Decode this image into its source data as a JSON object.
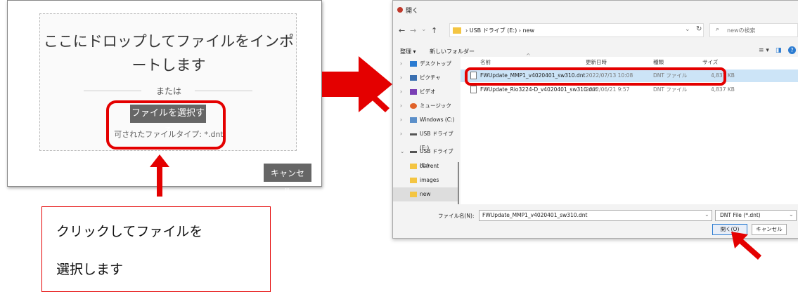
{
  "import_panel": {
    "drop_text_line1": "ここにドロップしてファイルをインポ",
    "drop_text_line2": "ートします",
    "or_label": "または",
    "select_button": "ファイルを選択する",
    "allowed_types": "可されたファイルタイプ: *.dnt",
    "cancel_button": "キャンセル"
  },
  "callout": {
    "line1": "クリックしてファイルを",
    "line2": "選択します"
  },
  "dialog": {
    "title": "開く",
    "nav_back": "←",
    "nav_forward": "→",
    "nav_dropdown": "⌄",
    "nav_up": "↑",
    "address_path": "›  USB ドライブ (E:)  ›  new",
    "address_chevron": "⌄",
    "refresh": "↻",
    "search_icon": "⌕",
    "search_placeholder": "newの検索",
    "organize": "整理 ▾",
    "new_folder": "新しいフォルダー",
    "view_icon": "≡ ▾",
    "pane_icon": "◨",
    "help_icon": "?",
    "nav_items": [
      {
        "chev": "›",
        "label": "デスクトップ",
        "color": "#2b7bd1"
      },
      {
        "chev": "›",
        "label": "ピクチャ",
        "color": "#3a6fb0"
      },
      {
        "chev": "›",
        "label": "ビデオ",
        "color": "#7a3fb5"
      },
      {
        "chev": "›",
        "label": "ミュージック",
        "color": "#e0622a"
      },
      {
        "chev": "›",
        "label": "Windows (C:)",
        "color": "#5b8fc9"
      },
      {
        "chev": "›",
        "label": "USB ドライブ (E:)",
        "color": "#555555"
      },
      {
        "chev": "⌄",
        "label": "USB ドライブ (E:)",
        "color": "#555555"
      },
      {
        "chev": "",
        "label": "current",
        "color": "#f4c542"
      },
      {
        "chev": "",
        "label": "images",
        "color": "#f4c542"
      },
      {
        "chev": "",
        "label": "new",
        "color": "#f4c542"
      }
    ],
    "columns": {
      "name": "名前",
      "date": "更新日時",
      "type": "種類",
      "size": "サイズ"
    },
    "sort_caret": "^",
    "files": [
      {
        "name": "FWUpdate_MMP1_v4020401_sw310.dnt",
        "date": "2022/07/13 10:08",
        "type": "DNT ファイル",
        "size": "4,837 KB"
      },
      {
        "name": "FWUpdate_Rio3224-D_v4020401_sw310.dnt",
        "date": "2022/06/21 9:57",
        "type": "DNT ファイル",
        "size": "4,837 KB"
      }
    ],
    "filename_label": "ファイル名(N):",
    "filename_value": "FWUpdate_MMP1_v4020401_sw310.dnt",
    "filename_chevron": "⌄",
    "filetype_value": "DNT File (*.dnt)",
    "filetype_chevron": "⌄",
    "open_button": "開く(O)",
    "cancel_button": "キャンセル"
  },
  "colors": {
    "highlight": "#e40000",
    "selection": "#cce4f7",
    "accent": "#2b7bd1"
  }
}
